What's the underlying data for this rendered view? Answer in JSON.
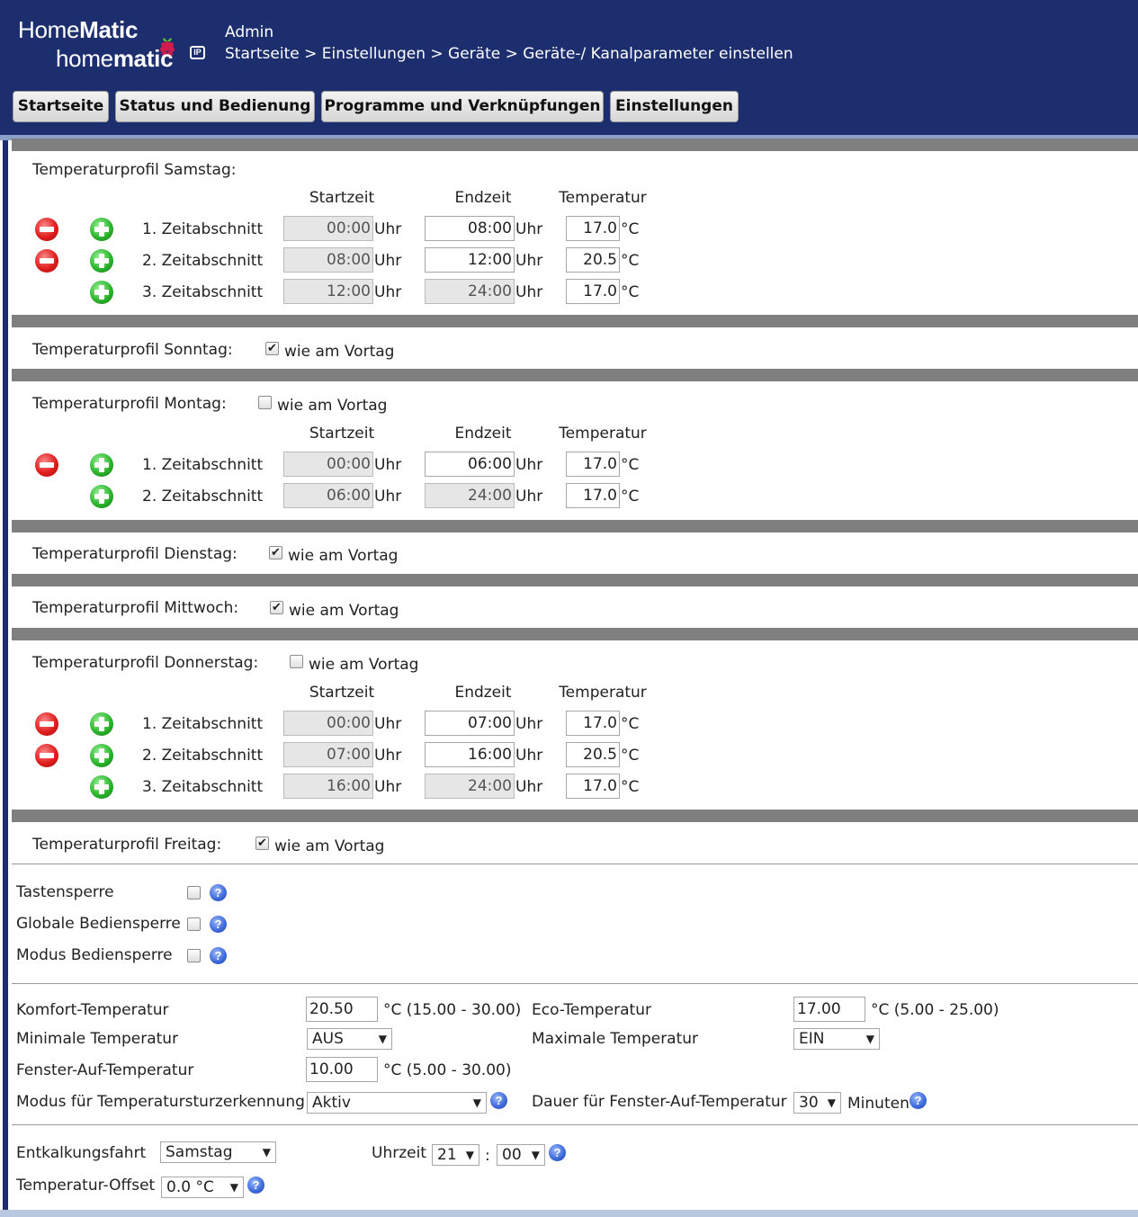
{
  "header": {
    "logo_top_regular": "Home",
    "logo_top_bold": "Matic",
    "logo_bottom_regular": "home",
    "logo_bottom_bold": "matic",
    "logo_badge": "IP",
    "user": "Admin",
    "breadcrumb": "Startseite > Einstellungen > Geräte > Geräte-/ Kanalparameter einstellen"
  },
  "nav": [
    "Startseite",
    "Status und Bedienung",
    "Programme und Verknüpfungen",
    "Einstellungen"
  ],
  "columns": {
    "start": "Startzeit",
    "end": "Endzeit",
    "temp": "Temperatur"
  },
  "units": {
    "time": "Uhr",
    "temp": "°C"
  },
  "same_as_prev_label": "wie am Vortag",
  "profiles": {
    "samstag": {
      "label": "Temperaturprofil Samstag:",
      "rows": [
        {
          "name": "1. Zeitabschnitt",
          "start": "00:00",
          "end": "08:00",
          "temp": "17.0"
        },
        {
          "name": "2. Zeitabschnitt",
          "start": "08:00",
          "end": "12:00",
          "temp": "20.5"
        },
        {
          "name": "3. Zeitabschnitt",
          "start": "12:00",
          "end": "24:00",
          "temp": "17.0"
        }
      ]
    },
    "sonntag": {
      "label": "Temperaturprofil Sonntag:",
      "same_as_prev": true
    },
    "montag": {
      "label": "Temperaturprofil Montag:",
      "same_as_prev": false,
      "rows": [
        {
          "name": "1. Zeitabschnitt",
          "start": "00:00",
          "end": "06:00",
          "temp": "17.0"
        },
        {
          "name": "2. Zeitabschnitt",
          "start": "06:00",
          "end": "24:00",
          "temp": "17.0"
        }
      ]
    },
    "dienstag": {
      "label": "Temperaturprofil Dienstag:",
      "same_as_prev": true
    },
    "mittwoch": {
      "label": "Temperaturprofil Mittwoch:",
      "same_as_prev": true
    },
    "donnerstag": {
      "label": "Temperaturprofil Donnerstag:",
      "same_as_prev": false,
      "rows": [
        {
          "name": "1. Zeitabschnitt",
          "start": "00:00",
          "end": "07:00",
          "temp": "17.0"
        },
        {
          "name": "2. Zeitabschnitt",
          "start": "07:00",
          "end": "16:00",
          "temp": "20.5"
        },
        {
          "name": "3. Zeitabschnitt",
          "start": "16:00",
          "end": "24:00",
          "temp": "17.0"
        }
      ]
    },
    "freitag": {
      "label": "Temperaturprofil Freitag:",
      "same_as_prev": true
    }
  },
  "locks": [
    {
      "label": "Tastensperre",
      "checked": false
    },
    {
      "label": "Globale Bediensperre",
      "checked": false
    },
    {
      "label": "Modus Bediensperre",
      "checked": false
    }
  ],
  "params": {
    "komfort": {
      "label": "Komfort-Temperatur",
      "value": "20.50",
      "range": "°C (15.00 - 30.00)"
    },
    "eco": {
      "label": "Eco-Temperatur",
      "value": "17.00",
      "range": "°C (5.00 - 25.00)"
    },
    "min_temp": {
      "label": "Minimale Temperatur",
      "value": "AUS"
    },
    "max_temp": {
      "label": "Maximale Temperatur",
      "value": "EIN"
    },
    "fenster": {
      "label": "Fenster-Auf-Temperatur",
      "value": "10.00",
      "range": "°C (5.00 - 30.00)"
    },
    "sturz": {
      "label": "Modus für Temperatursturzerkennung",
      "value": "Aktiv"
    },
    "dauer": {
      "label": "Dauer für Fenster-Auf-Temperatur",
      "value": "30",
      "unit": "Minuten"
    }
  },
  "entkalkung": {
    "label": "Entkalkungsfahrt",
    "day": "Samstag",
    "time_label": "Uhrzeit",
    "hour": "21",
    "colon": ":",
    "minute": "00"
  },
  "offset": {
    "label": "Temperatur-Offset",
    "value": "0.0 °C"
  },
  "icons": {
    "remove": "remove-period-icon",
    "add": "add-period-icon",
    "help": "help-icon",
    "help_glyph": "?",
    "dropdown": "chevron-down-icon",
    "dropdown_glyph": "▼",
    "check_glyph": "✔"
  },
  "colors": {
    "header_bg": "#1d2e6e",
    "separator": "#7f7f7f",
    "disabled_input": "#e6e6e6"
  }
}
